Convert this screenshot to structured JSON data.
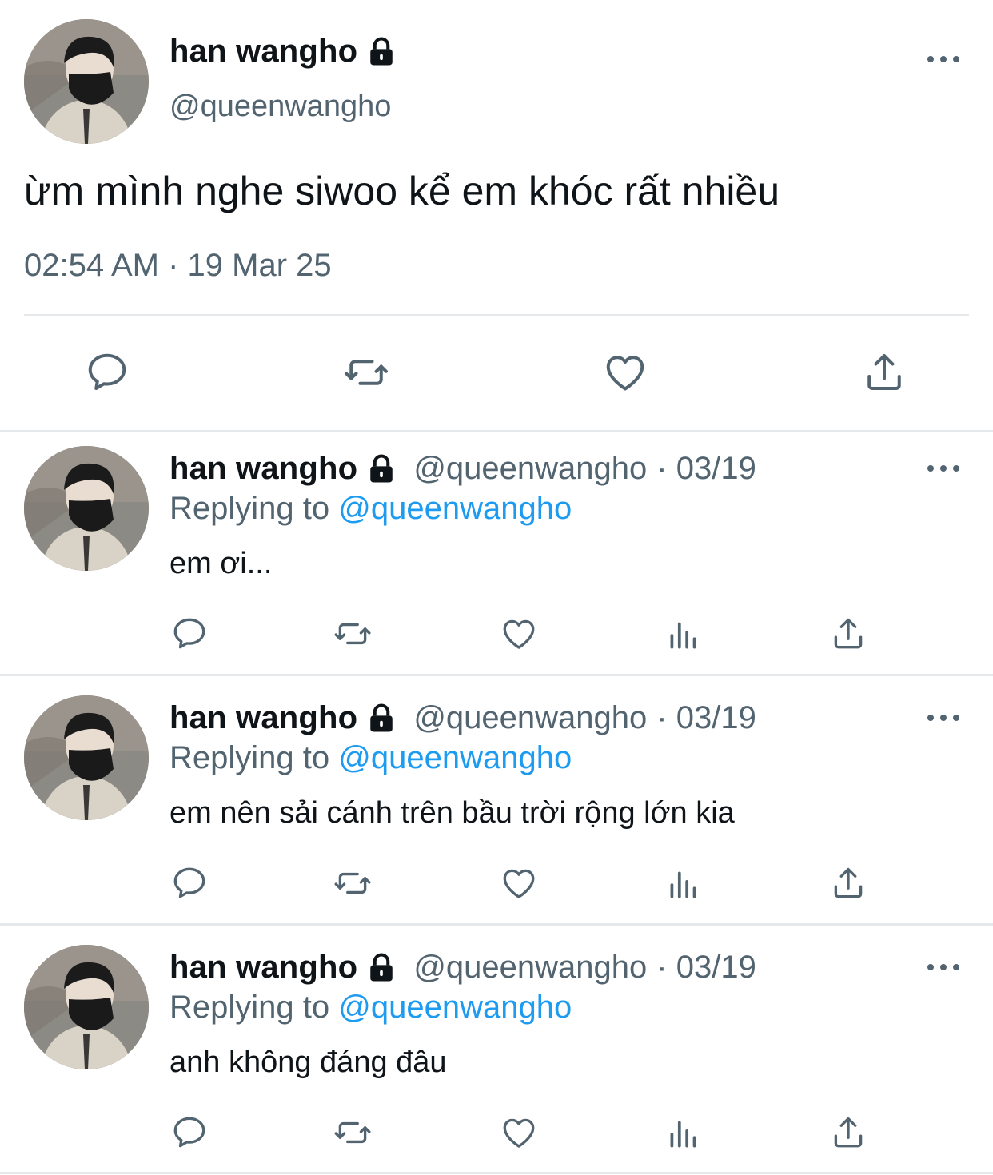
{
  "main_tweet": {
    "display_name": "han wangho",
    "handle": "@queenwangho",
    "text": "ừm mình nghe siwoo kể em khóc rất nhiều",
    "timestamp": "02:54 AM · 19 Mar 25"
  },
  "replies": [
    {
      "display_name": "han wangho",
      "handle": "@queenwangho",
      "date": "· 03/19",
      "replying_label": "Replying to ",
      "replying_to": "@queenwangho",
      "text": "em ơi..."
    },
    {
      "display_name": "han wangho",
      "handle": "@queenwangho",
      "date": "· 03/19",
      "replying_label": "Replying to ",
      "replying_to": "@queenwangho",
      "text": "em nên sải cánh trên bầu trời rộng lớn kia"
    },
    {
      "display_name": "han wangho",
      "handle": "@queenwangho",
      "date": "· 03/19",
      "replying_label": "Replying to ",
      "replying_to": "@queenwangho",
      "text": "anh không đáng đâu"
    }
  ],
  "icons": {
    "lock": "lock-icon",
    "more": "more-icon",
    "reply": "reply-icon",
    "retweet": "retweet-icon",
    "like": "heart-icon",
    "views": "views-icon",
    "share": "share-icon"
  },
  "colors": {
    "text_primary": "#0f1419",
    "text_secondary": "#536471",
    "link": "#1d9bf0",
    "divider": "#e6e9eb"
  }
}
